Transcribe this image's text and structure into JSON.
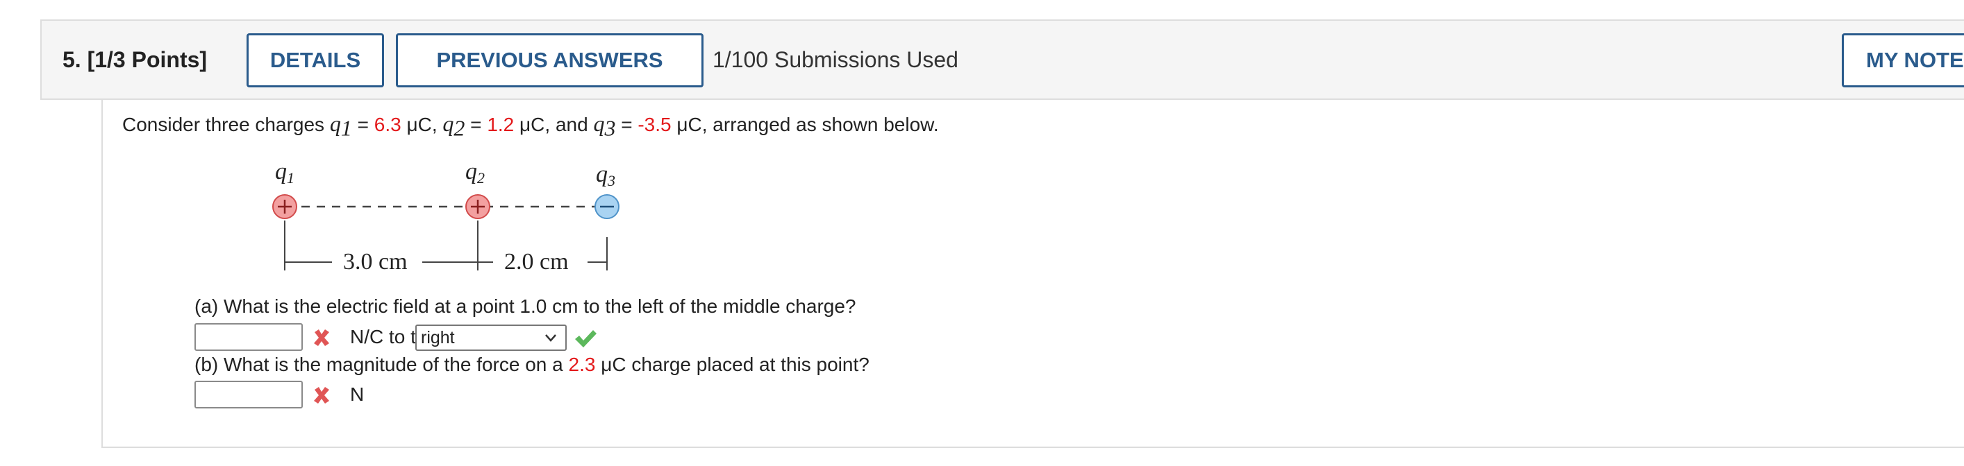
{
  "header": {
    "question_number": "5.",
    "points": "[1/3 Points]",
    "details_label": "DETAILS",
    "previous_answers_label": "PREVIOUS ANSWERS",
    "submissions": "1/100 Submissions Used",
    "my_notes_label": "MY NOTES"
  },
  "prompt": {
    "t1": "Consider three charges ",
    "q1_var": "q",
    "q1_sub": "1",
    "eq1": " = ",
    "q1_value": "6.3",
    "unit1": " μC, ",
    "q2_var": "q",
    "q2_sub": "2",
    "eq2": " = ",
    "q2_value": "1.2",
    "unit2": " μC, and ",
    "q3_var": "q",
    "q3_sub": "3",
    "eq3": " = ",
    "q3_value": "-3.5",
    "unit3": " μC, arranged as shown below."
  },
  "figure": {
    "label_q1": "q",
    "label_q1_sub": "1",
    "label_q2": "q",
    "label_q2_sub": "2",
    "label_q3": "q",
    "label_q3_sub": "3",
    "dist1": "3.0 cm",
    "dist2": "2.0 cm",
    "positive_color": "#e76b6b",
    "negative_color": "#6aaee0"
  },
  "part_a": {
    "t1": "(a) What is the electric field at a point 1.0 cm to the left of the middle charge?",
    "input_value": "",
    "unit": "N/C to the",
    "selected": "right"
  },
  "part_b": {
    "t1": "(b) What is the magnitude of the force on a ",
    "value": "2.3",
    "t2": " μC charge placed at this point?",
    "input_value": "",
    "unit": "N"
  },
  "colors": {
    "accent": "#2a5b8c",
    "highlight": "#e3191b",
    "wrong": "#e05555",
    "correct": "#5cb85c"
  }
}
